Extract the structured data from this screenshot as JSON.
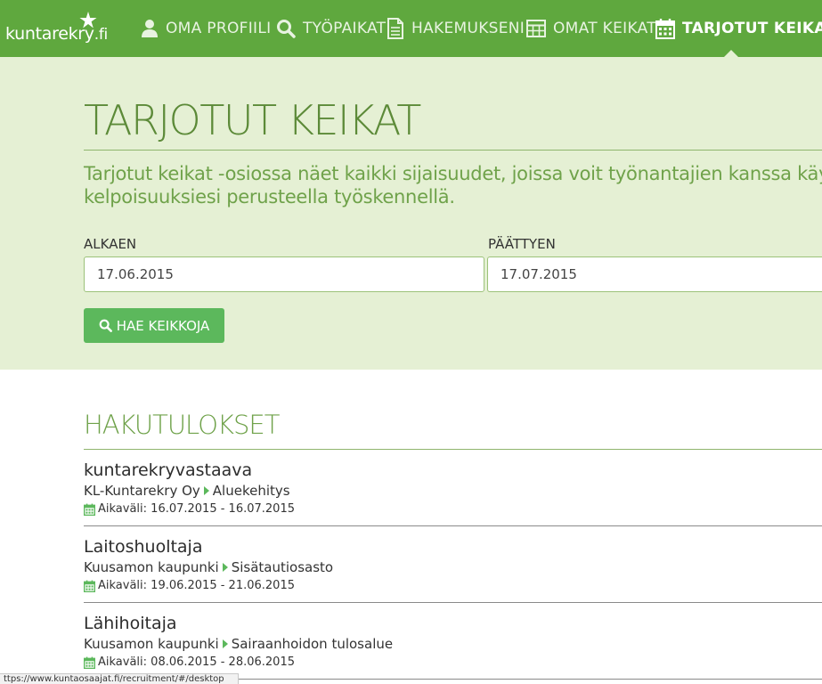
{
  "brand": {
    "logo_text": "kuntarekry",
    "logo_suffix": ".fi"
  },
  "nav": {
    "items": [
      {
        "label": "OMA PROFIILI",
        "icon": "user-icon"
      },
      {
        "label": "TYÖPAIKAT",
        "icon": "search-icon"
      },
      {
        "label": "HAKEMUKSENI",
        "icon": "document-icon"
      },
      {
        "label": "OMAT KEIKAT",
        "icon": "table-icon"
      },
      {
        "label": "TARJOTUT KEIKAT",
        "icon": "calendar-icon",
        "active": true
      }
    ]
  },
  "hero": {
    "title": "TARJOTUT KEIKAT",
    "intro_line1": "Tarjotut keikat -osiossa näet kaikki sijaisuudet, joissa voit työnantajien kanssa käyn",
    "intro_line2": "kelpoisuuksiesi perusteella työskennellä.",
    "start_label": "ALKAEN",
    "start_value": "17.06.2015",
    "end_label": "PÄÄTTYEN",
    "end_value": "17.07.2015",
    "search_button": "HAE KEIKKOJA"
  },
  "results": {
    "title": "HAKUTULOKSET",
    "items": [
      {
        "title": "kuntarekryvastaava",
        "employer": "KL-Kuntarekry Oy",
        "unit": "Aluekehitys",
        "period": "Aikaväli: 16.07.2015 - 16.07.2015"
      },
      {
        "title": "Laitoshuoltaja",
        "employer": "Kuusamon kaupunki",
        "unit": "Sisätautiosasto",
        "period": "Aikaväli: 19.06.2015 - 21.06.2015"
      },
      {
        "title": "Lähihoitaja",
        "employer": "Kuusamon kaupunki",
        "unit": "Sairaanhoidon tulosalue",
        "period": "Aikaväli: 08.06.2015 - 28.06.2015"
      }
    ]
  },
  "status_bar": {
    "url": "ttps://www.kuntaosaajat.fi/recruitment/#/desktop"
  },
  "colors": {
    "nav_green": "#5fa83e",
    "hero_bg": "#e5f0d4",
    "title_green": "#5c8a38",
    "button_green": "#5cb85c"
  }
}
